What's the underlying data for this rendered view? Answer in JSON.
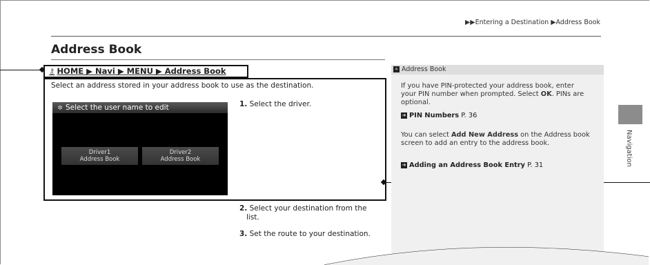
{
  "breadcrumb_top": "▶▶Entering a Destination ▶Address Book",
  "page_title": "Address Book",
  "path": {
    "icon": "key-icon",
    "text": "HOME ▶ Navi ▶ MENU ▶ Address Book"
  },
  "intro": "Select an address stored in your address book to use as the destination.",
  "screen": {
    "header": "Select the user name to edit",
    "button1_line1": "Driver1",
    "button1_line2": "Address Book",
    "button2_line1": "Driver2",
    "button2_line2": "Address Book"
  },
  "steps": [
    {
      "num": "1.",
      "text": "Select the driver."
    },
    {
      "num": "2.",
      "text_line1": "Select your destination from the",
      "text_line2": "list."
    },
    {
      "num": "3.",
      "text": "Set the route to your destination."
    }
  ],
  "sidebar": {
    "header": "Address Book",
    "para1_a": "If you have PIN-protected your address book, enter your PIN number when prompted. Select",
    "para1_bold": "OK",
    "para1_b": ". PINs are optional.",
    "link1_text": "PIN Numbers",
    "link1_page": "P. 36",
    "para2_a": "You can select",
    "para2_bold": "Add New Address",
    "para2_b": "on the Address book screen to add an entry to the address book.",
    "link2_text": "Adding an Address Book Entry",
    "link2_page": "P. 31"
  },
  "side_tab": "Navigation"
}
